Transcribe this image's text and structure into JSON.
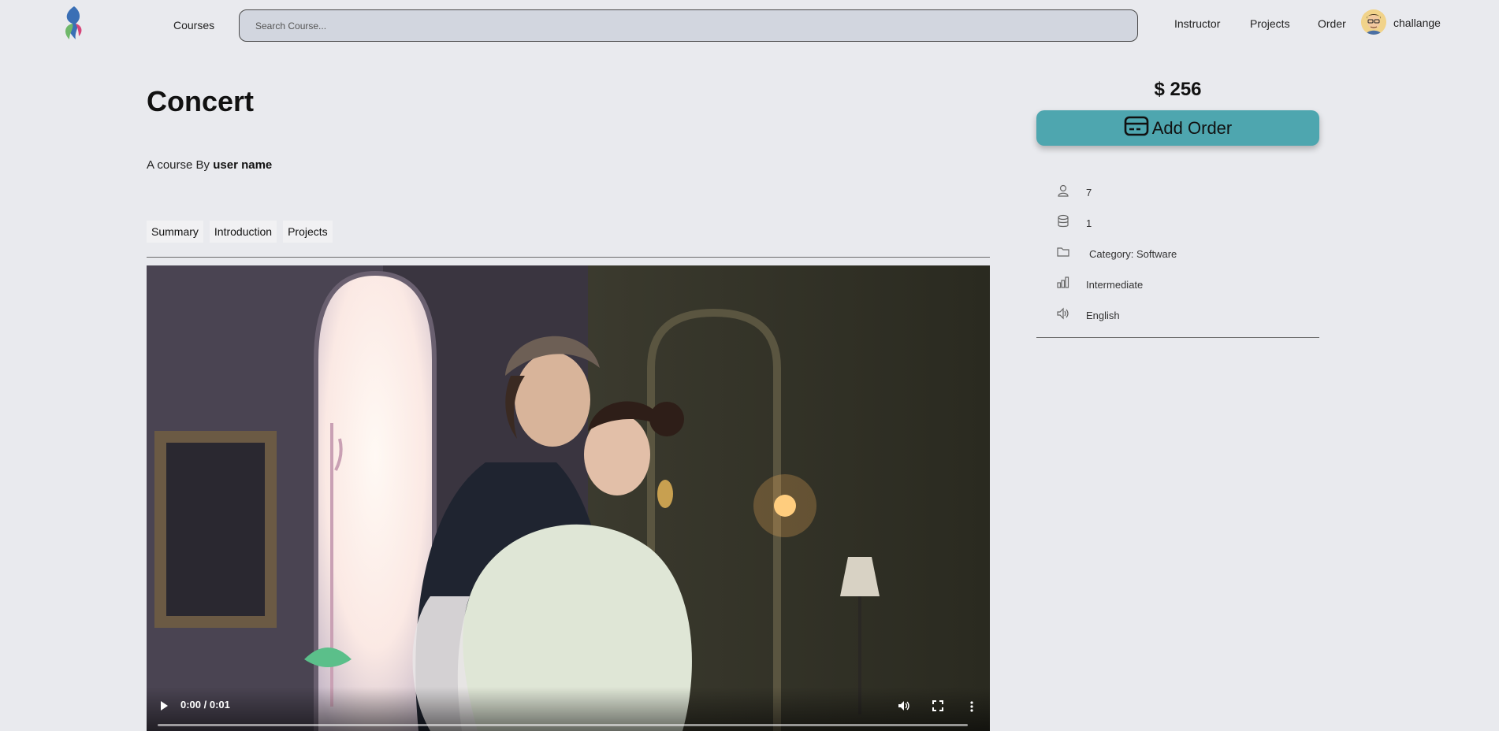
{
  "header": {
    "nav_courses": "Courses",
    "search_placeholder": "Search Course...",
    "nav_instructor": "Instructor",
    "nav_projects": "Projects",
    "nav_order": "Order",
    "username": "challange"
  },
  "course": {
    "title": "Concert",
    "byline_prefix": "A course By ",
    "author": "user name"
  },
  "tabs": [
    {
      "label": "Summary"
    },
    {
      "label": "Introduction"
    },
    {
      "label": "Projects"
    }
  ],
  "video": {
    "time": "0:00 / 0:01",
    "progress": 0
  },
  "sidebar": {
    "price": "$ 256",
    "order_button": "Add Order",
    "info": [
      {
        "icon": "user-icon",
        "text": "7"
      },
      {
        "icon": "database-icon",
        "text": "1"
      },
      {
        "icon": "folder-icon",
        "text": "Category: Software"
      },
      {
        "icon": "level-bars-icon",
        "text": "Intermediate"
      },
      {
        "icon": "speaker-icon",
        "text": "English"
      }
    ]
  },
  "colors": {
    "background": "#e9eaee",
    "accent_button": "#4ea6af",
    "search_bg": "#d2d6df"
  }
}
